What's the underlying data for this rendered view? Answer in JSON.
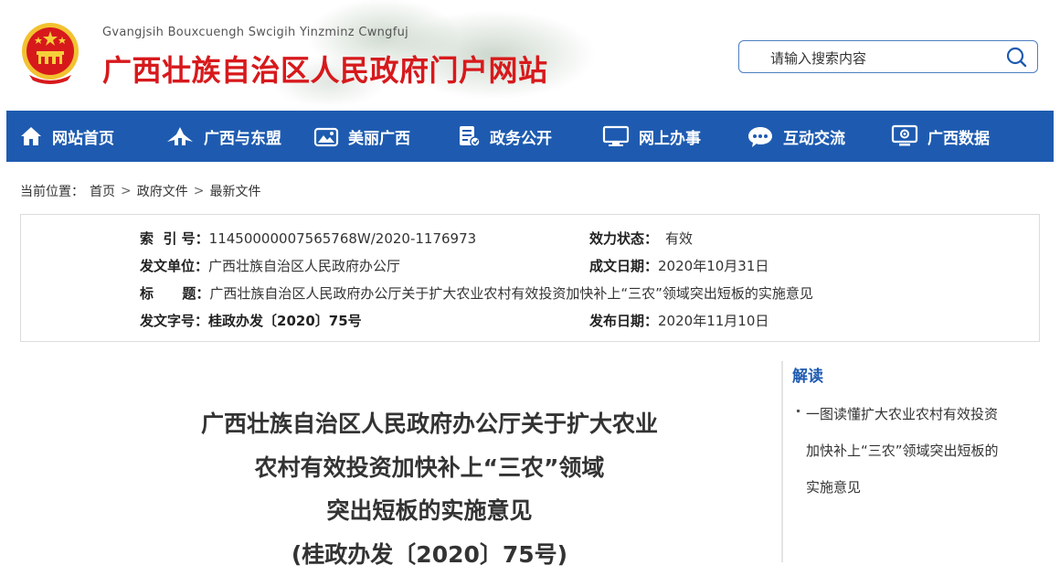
{
  "header": {
    "subtitle": "Gvangjsih Bouxcuengh Swcigih Yinzminz Cwngfuj",
    "title": "广西壮族自治区人民政府门户网站",
    "search_placeholder": "请输入搜索内容",
    "brand_red": "#d7191c",
    "nav_blue": "#1e5bb0"
  },
  "nav": [
    {
      "label": "网站首页",
      "icon": "home-icon"
    },
    {
      "label": "广西与东盟",
      "icon": "pavilion-icon"
    },
    {
      "label": "美丽广西",
      "icon": "landscape-icon"
    },
    {
      "label": "政务公开",
      "icon": "document-icon"
    },
    {
      "label": "网上办事",
      "icon": "monitor-icon"
    },
    {
      "label": "互动交流",
      "icon": "chat-icon"
    },
    {
      "label": "广西数据",
      "icon": "screen-data-icon"
    }
  ],
  "breadcrumb": {
    "prefix": "当前位置：",
    "items": [
      "首页",
      "政府文件",
      "最新文件"
    ],
    "sep": ">"
  },
  "info": {
    "index_label": "索  引 号：",
    "index_value": "11450000007565768W/2020-1176973",
    "status_label": "效力状态：",
    "status_value": "有效",
    "issuer_label": "发文单位：",
    "issuer_value": "广西壮族自治区人民政府办公厅",
    "created_label": "成文日期：",
    "created_value": "2020年10月31日",
    "title_label": "标      题：",
    "title_value": "广西壮族自治区人民政府办公厅关于扩大农业农村有效投资加快补上“三农”领域突出短板的实施意见",
    "docno_label": "发文字号：",
    "docno_value": "桂政办发〔2020〕75号",
    "published_label": "发布日期：",
    "published_value": "2020年11月10日"
  },
  "article": {
    "title_lines": [
      "广西壮族自治区人民政府办公厅关于扩大农业",
      "农村有效投资加快补上“三农”领域",
      "突出短板的实施意见",
      "(桂政办发〔2020〕75号)"
    ]
  },
  "sidebar": {
    "heading": "解读",
    "link": "一图读懂扩大农业农村有效投资加快补上“三农”领域突出短板的实施意见"
  }
}
